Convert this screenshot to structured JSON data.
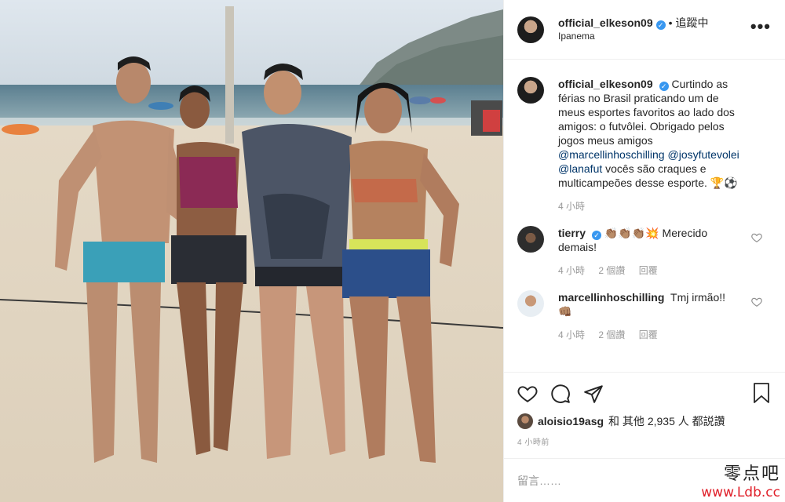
{
  "post": {
    "author": "official_elkeson09",
    "follow_state": "追蹤中",
    "dot": "•",
    "location": "Ipanema",
    "more_glyph": "•••"
  },
  "caption": {
    "username": "official_elkeson09",
    "text_1": "Curtindo as férias no Brasil praticando um de meus esportes favoritos ao lado dos amigos: o futvôlei. Obrigado pelos jogos meus amigos ",
    "mention_1": "@marcellinhoschilling",
    "mention_2": "@josyfutevolei",
    "mention_3": "@lanafut",
    "text_2": " vocês são craques e multicampeões desse esporte. ",
    "emoji": "🏆⚽",
    "time": "4 小時"
  },
  "comments": [
    {
      "username": "tierry",
      "emoji": "👏🏽👏🏽👏🏽💥",
      "text": " Merecido demais!",
      "time": "4 小時",
      "likes": "2 個讚",
      "reply": "回覆"
    },
    {
      "username": "marcellinhoschilling",
      "text": "Tmj irmão!!",
      "emoji": "👊🏽",
      "time": "4 小時",
      "likes": "2 個讚",
      "reply": "回覆"
    }
  ],
  "likes": {
    "username": "aloisio19asg",
    "rest": "和 其他 2,935 人 都説讚"
  },
  "timestamp": "4 小時前",
  "comment_input": {
    "placeholder": "留言……"
  },
  "watermark": {
    "line1": "零点吧",
    "line2": "www.Ldb.cc"
  },
  "colors": {
    "verified": "#3897f0",
    "mention": "#003569",
    "watermark_red": "#e0202a"
  }
}
